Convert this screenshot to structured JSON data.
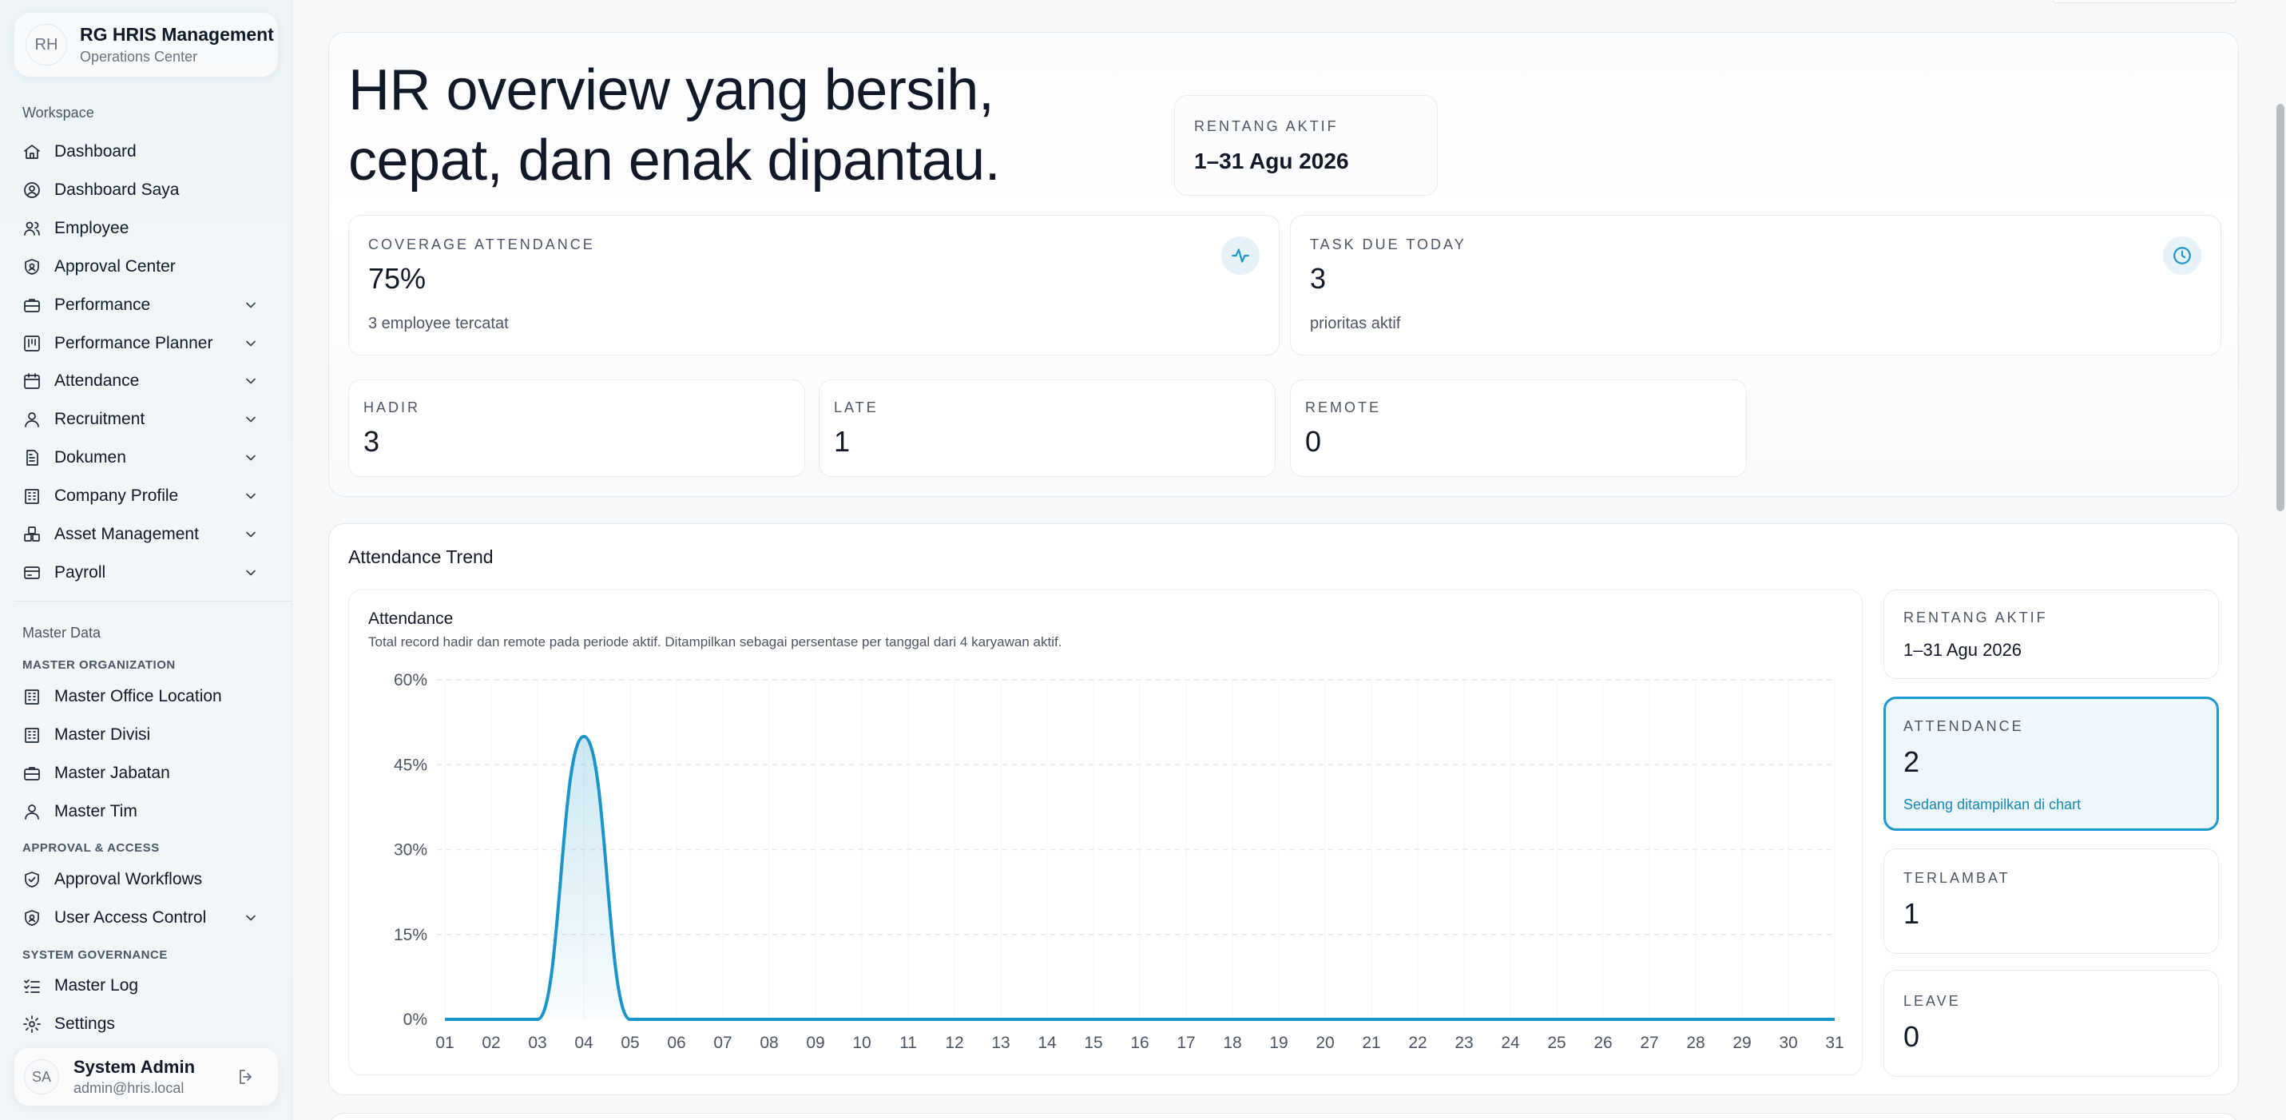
{
  "brand": {
    "initials": "RH",
    "title": "RG HRIS Management",
    "subtitle": "Operations Center"
  },
  "sidebar": {
    "workspace_label": "Workspace",
    "workspace_items": [
      {
        "label": "Dashboard",
        "icon": "home-icon"
      },
      {
        "label": "Dashboard Saya",
        "icon": "user-circle-icon"
      },
      {
        "label": "Employee",
        "icon": "users-icon"
      },
      {
        "label": "Approval Center",
        "icon": "shield-icon"
      },
      {
        "label": "Performance",
        "icon": "briefcase-icon",
        "expandable": true
      },
      {
        "label": "Performance Planner",
        "icon": "kanban-icon",
        "expandable": true
      },
      {
        "label": "Attendance",
        "icon": "calendar-icon",
        "expandable": true
      },
      {
        "label": "Recruitment",
        "icon": "user-icon",
        "expandable": true
      },
      {
        "label": "Dokumen",
        "icon": "document-icon",
        "expandable": true
      },
      {
        "label": "Company Profile",
        "icon": "building-icon",
        "expandable": true
      },
      {
        "label": "Asset Management",
        "icon": "boxes-icon",
        "expandable": true
      },
      {
        "label": "Payroll",
        "icon": "credit-card-icon",
        "expandable": true
      }
    ],
    "master_label": "Master Data",
    "master_org_label": "MASTER ORGANIZATION",
    "master_org_items": [
      {
        "label": "Master Office Location",
        "icon": "building-icon"
      },
      {
        "label": "Master Divisi",
        "icon": "building-icon"
      },
      {
        "label": "Master Jabatan",
        "icon": "briefcase-icon"
      },
      {
        "label": "Master Tim",
        "icon": "user-icon"
      }
    ],
    "approval_label": "APPROVAL & ACCESS",
    "approval_items": [
      {
        "label": "Approval Workflows",
        "icon": "shield-check-icon"
      },
      {
        "label": "User Access Control",
        "icon": "shield-icon",
        "expandable": true
      }
    ],
    "governance_label": "SYSTEM GOVERNANCE",
    "governance_items": [
      {
        "label": "Master Log",
        "icon": "list-check-icon"
      },
      {
        "label": "Settings",
        "icon": "gear-icon"
      }
    ]
  },
  "user": {
    "initials": "SA",
    "name": "System Admin",
    "email": "admin@hris.local"
  },
  "hero": {
    "title_line1": "HR overview yang bersih,",
    "title_line2": "cepat, dan enak dipantau.",
    "range_label": "RENTANG AKTIF",
    "range_value": "1–31 Agu 2026",
    "coverage": {
      "label": "COVERAGE ATTENDANCE",
      "value": "75%",
      "note": "3 employee tercatat"
    },
    "task": {
      "label": "TASK DUE TODAY",
      "value": "3",
      "note": "prioritas aktif"
    },
    "hadir": {
      "label": "HADIR",
      "value": "3"
    },
    "late": {
      "label": "LATE",
      "value": "1"
    },
    "remote": {
      "label": "REMOTE",
      "value": "0"
    }
  },
  "trend": {
    "title": "Attendance Trend",
    "chart_title": "Attendance",
    "chart_subtitle": "Total record hadir dan remote pada periode aktif. Ditampilkan sebagai persentase per tanggal dari 4 karyawan aktif.",
    "range": {
      "label": "RENTANG AKTIF",
      "value": "1–31 Agu 2026"
    },
    "attendance": {
      "label": "ATTENDANCE",
      "value": "2",
      "note": "Sedang ditampilkan di chart"
    },
    "terlambat": {
      "label": "TERLAMBAT",
      "value": "1"
    },
    "leave": {
      "label": "LEAVE",
      "value": "0"
    }
  },
  "colors": {
    "accent": "#1b9ad1",
    "line": "#1b95c9"
  },
  "chart_data": {
    "type": "area",
    "x": [
      "01",
      "02",
      "03",
      "04",
      "05",
      "06",
      "07",
      "08",
      "09",
      "10",
      "11",
      "12",
      "13",
      "14",
      "15",
      "16",
      "17",
      "18",
      "19",
      "20",
      "21",
      "22",
      "23",
      "24",
      "25",
      "26",
      "27",
      "28",
      "29",
      "30",
      "31"
    ],
    "series": [
      {
        "values": [
          0,
          0,
          0,
          50,
          0,
          0,
          0,
          0,
          0,
          0,
          0,
          0,
          0,
          0,
          0,
          0,
          0,
          0,
          0,
          0,
          0,
          0,
          0,
          0,
          0,
          0,
          0,
          0,
          0,
          0,
          0
        ]
      }
    ],
    "y_ticks": [
      "0%",
      "15%",
      "30%",
      "45%",
      "60%"
    ],
    "ylim": [
      0,
      60
    ],
    "grid": true
  }
}
